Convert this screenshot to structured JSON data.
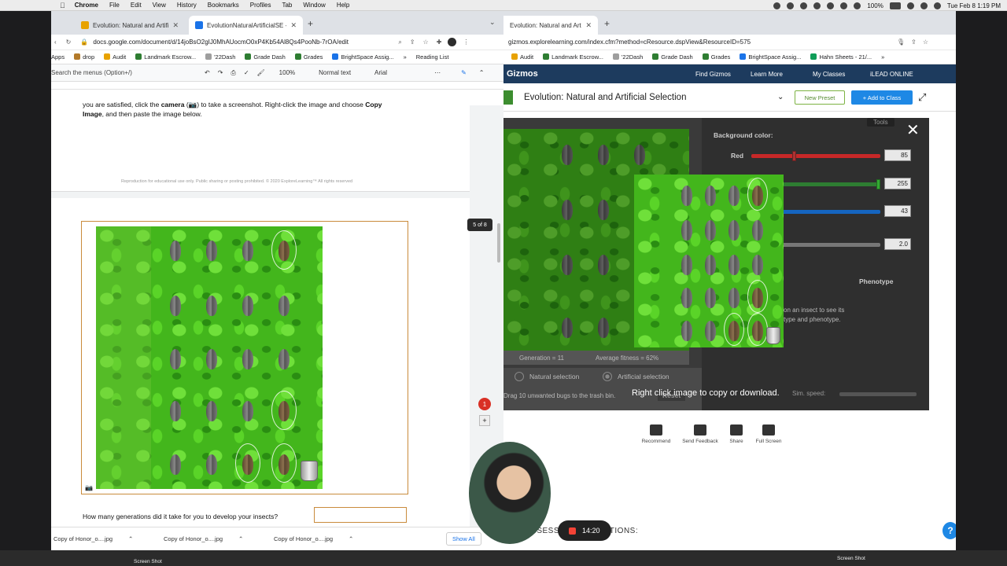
{
  "menubar": {
    "apple": "",
    "items": [
      "Chrome",
      "File",
      "Edit",
      "View",
      "History",
      "Bookmarks",
      "Profiles",
      "Tab",
      "Window",
      "Help"
    ],
    "battery": "100%",
    "clock": "Tue Feb 8  1:19 PM"
  },
  "left": {
    "tabs": [
      {
        "title": "Evolution: Natural and Artificial",
        "color": "#e8a200"
      },
      {
        "title": "EvolutionNaturalArtificialSE - G",
        "color": "#1a73e8"
      }
    ],
    "address": "docs.google.com/document/d/14joBsO2gIJ0MhAUocmO0xP4Kb54Al8Qs4PooNb-7rOA/edit",
    "bookmarks": [
      "Apps",
      "drop",
      "Audit",
      "Landmark Escrow...",
      "'22Dash",
      "Grade Dash",
      "Grades",
      "BrightSpace Assig...",
      "Reading List"
    ],
    "toolbar": {
      "menu_search": "Search the menus (Option+/)",
      "zoom": "100%",
      "style": "Normal text",
      "font": "Arial"
    },
    "doc": {
      "instruction_1": "you are satisfied, click the ",
      "instruction_bold_1": "camera",
      "instruction_2": " to take a screenshot. Right-click the image and choose ",
      "instruction_bold_2": "Copy",
      "instruction_bold_3": "Image",
      "instruction_3": ", and then paste the image below.",
      "footer": "Reproduction for educational use only. Public sharing or posting prohibited. © 2020 ExploreLearning™ All rights reserved",
      "question": "How many generations did it take for you to develop your insects?",
      "page_indicator": "5 of 8"
    },
    "downloads": [
      "Copy of Honor_o....jpg",
      "Copy of Honor_o....jpg",
      "Copy of Honor_o....jpg"
    ],
    "show_all": "Show All"
  },
  "right": {
    "tabs": [
      {
        "title": "Evolution: Natural and Artificial"
      }
    ],
    "address": "gizmos.explorelearning.com/index.cfm?method=cResource.dspView&ResourceID=575",
    "bookmarks": [
      "Audit",
      "Landmark Escrow...",
      "'22Dash",
      "Grade Dash",
      "Grades",
      "BrightSpace Assig...",
      "Hahn Sheets - 21/..."
    ],
    "nav": {
      "brand": "Gizmos",
      "find": "Find Gizmos",
      "learn": "Learn More",
      "classes": "My Classes",
      "ilead": "iLEAD ONLINE"
    },
    "title": "Evolution: Natural and Artificial Selection",
    "new_preset": "New Preset",
    "add_to_class": "+ Add to Class",
    "panel": {
      "tools": "Tools",
      "bg_label": "Background color:",
      "red_label": "Red",
      "red": "85",
      "green": "255",
      "blue": "43",
      "rate": "2.0",
      "red_pct": 0.33,
      "green_pct": 1.0,
      "blue_pct": 0.17,
      "phenotype": "Phenotype",
      "hint_1": "on an insect to see its",
      "hint_2": "type and phenotype.",
      "sim_speed": "Sim. speed:"
    },
    "status": {
      "generation": "Generation = 11",
      "fitness": "Average fitness = 62%"
    },
    "modes": {
      "natural": "Natural selection",
      "artificial": "Artificial selection"
    },
    "drag_hint": "Drag 10 unwanted bugs to the trash bin.",
    "reset": "Reset",
    "overlay_msg": "Right click image to copy or download.",
    "footer": [
      {
        "label": "Recommend",
        "icon": "thumbs-up-icon"
      },
      {
        "label": "Send Feedback",
        "icon": "chat-icon"
      },
      {
        "label": "Share",
        "icon": "share-icon"
      },
      {
        "label": "Full Screen",
        "icon": "fullscreen-icon"
      }
    ],
    "assess": "ASSESSMENT QUESTIONS:"
  },
  "recording": {
    "time": "14:20"
  },
  "notification_count": "1",
  "taskbar": {
    "screenshot_1": "Screen Shot",
    "screenshot_2": "Screen Shot"
  }
}
